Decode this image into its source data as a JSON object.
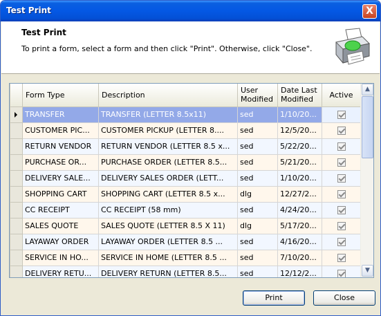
{
  "window": {
    "title": "Test Print",
    "close_glyph": "X"
  },
  "header": {
    "title": "Test Print",
    "description": "To print a form, select a form and then click \"Print\".  Otherwise, click \"Close\".",
    "icon": "printer-icon"
  },
  "grid": {
    "columns": [
      "Form Type",
      "Description",
      "User Modified",
      "Date Last Modified",
      "Active"
    ],
    "column_lines": [
      [
        "Form Type"
      ],
      [
        "Description"
      ],
      [
        "User",
        "Modified"
      ],
      [
        "Date Last",
        "Modified"
      ],
      [
        "Active"
      ]
    ],
    "rows": [
      {
        "form_type": "TRANSFER",
        "description": "TRANSFER (LETTER 8.5x11)",
        "user": "sed",
        "date": "1/10/20...",
        "active": true,
        "selected": true
      },
      {
        "form_type": "CUSTOMER PIC...",
        "description": "CUSTOMER PICKUP (LETTER 8....",
        "user": "sed",
        "date": "12/5/20...",
        "active": true
      },
      {
        "form_type": "RETURN VENDOR",
        "description": "RETURN VENDOR (LETTER 8.5 x...",
        "user": "sed",
        "date": "5/22/20...",
        "active": true
      },
      {
        "form_type": "PURCHASE OR...",
        "description": "PURCHASE ORDER (LETTER 8.5...",
        "user": "sed",
        "date": "5/21/20...",
        "active": true
      },
      {
        "form_type": "DELIVERY SALE...",
        "description": "DELIVERY SALES ORDER (LETT...",
        "user": "sed",
        "date": "1/10/20...",
        "active": true
      },
      {
        "form_type": "SHOPPING CART",
        "description": "SHOPPING CART (LETTER 8.5 x...",
        "user": "dlg",
        "date": "12/27/2...",
        "active": true
      },
      {
        "form_type": "CC RECEIPT",
        "description": "CC RECEIPT (58 mm)",
        "user": "sed",
        "date": "4/24/20...",
        "active": true
      },
      {
        "form_type": "SALES QUOTE",
        "description": "SALES QUOTE (LETTER 8.5 X 11)",
        "user": "dlg",
        "date": "5/17/20...",
        "active": true
      },
      {
        "form_type": "LAYAWAY ORDER",
        "description": "LAYAWAY ORDER (LETTER 8.5 ...",
        "user": "sed",
        "date": "4/16/20...",
        "active": true
      },
      {
        "form_type": "SERVICE IN HO...",
        "description": "SERVICE IN HOME (LETTER 8.5 ...",
        "user": "sed",
        "date": "7/10/20...",
        "active": true
      },
      {
        "form_type": "DELIVERY RETU...",
        "description": "DELIVERY RETURN (LETTER 8.5...",
        "user": "sed",
        "date": "12/12/2...",
        "active": true
      }
    ]
  },
  "buttons": {
    "print": "Print",
    "close": "Close"
  }
}
